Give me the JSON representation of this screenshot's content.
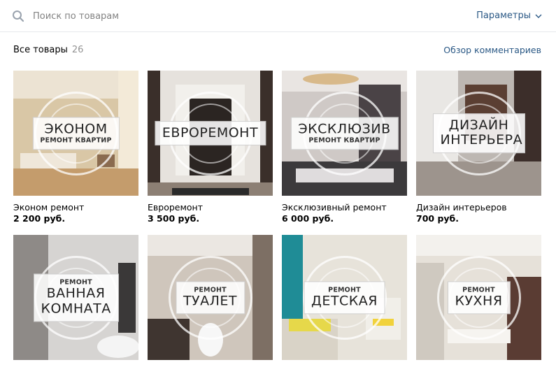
{
  "search": {
    "placeholder": "Поиск по товарам",
    "params_label": "Параметры"
  },
  "header": {
    "title": "Все товары",
    "count": "26",
    "reviews_link": "Обзор комментариев"
  },
  "products": [
    {
      "name": "Эконом ремонт",
      "price": "2 200 руб.",
      "plate_top": "",
      "plate_main": "ЭКОНОМ",
      "plate_bottom": "РЕМОНТ КВАРТИР"
    },
    {
      "name": "Евроремонт",
      "price": "3 500 руб.",
      "plate_top": "",
      "plate_main": "ЕВРОРЕМОНТ",
      "plate_bottom": ""
    },
    {
      "name": "Эксклюзивный ремонт",
      "price": "6 000 руб.",
      "plate_top": "",
      "plate_main": "ЭКСКЛЮЗИВ",
      "plate_bottom": "РЕМОНТ КВАРТИР"
    },
    {
      "name": "Дизайн интерьеров",
      "price": "700 руб.",
      "plate_top": "",
      "plate_main": "ДИЗАЙН ИНТЕРЬЕРА",
      "plate_bottom": ""
    },
    {
      "name": "",
      "price": "",
      "plate_top": "РЕМОНТ",
      "plate_main": "ВАННАЯ КОМНАТА",
      "plate_bottom": ""
    },
    {
      "name": "",
      "price": "",
      "plate_top": "РЕМОНТ",
      "plate_main": "ТУАЛЕТ",
      "plate_bottom": ""
    },
    {
      "name": "",
      "price": "",
      "plate_top": "РЕМОНТ",
      "plate_main": "ДЕТСКАЯ",
      "plate_bottom": ""
    },
    {
      "name": "",
      "price": "",
      "plate_top": "РЕМОНТ",
      "plate_main": "КУХНЯ",
      "plate_bottom": ""
    }
  ],
  "colors": {
    "link": "#2a5885",
    "muted": "#939393",
    "placeholder": "#828282",
    "divider": "#e7e8ec"
  },
  "icons": {
    "search": "search-icon",
    "params": "chevron-down-icon"
  }
}
